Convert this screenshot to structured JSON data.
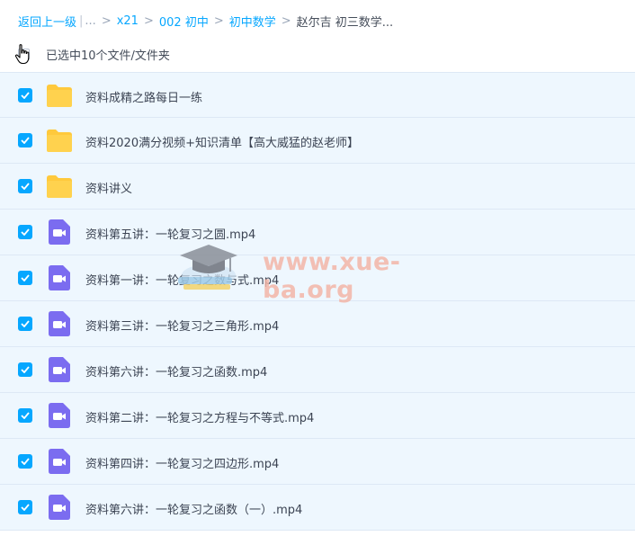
{
  "breadcrumb": {
    "back": "返回上一级",
    "more": "...",
    "items": [
      "x21",
      "002 初中",
      "初中数学"
    ],
    "current": "赵尔吉 初三数学..."
  },
  "selection": {
    "text": "已选中10个文件/文件夹"
  },
  "files": [
    {
      "type": "folder",
      "name": "资料成精之路每日一练"
    },
    {
      "type": "folder",
      "name": "资料2020满分视频+知识清单【高大威猛的赵老师】"
    },
    {
      "type": "folder",
      "name": "资料讲义"
    },
    {
      "type": "video",
      "name": "资料第五讲：一轮复习之圆.mp4"
    },
    {
      "type": "video",
      "name": "资料第一讲：一轮复习之数与式.mp4"
    },
    {
      "type": "video",
      "name": "资料第三讲：一轮复习之三角形.mp4"
    },
    {
      "type": "video",
      "name": "资料第六讲：一轮复习之函数.mp4"
    },
    {
      "type": "video",
      "name": "资料第二讲：一轮复习之方程与不等式.mp4"
    },
    {
      "type": "video",
      "name": "资料第四讲：一轮复习之四边形.mp4"
    },
    {
      "type": "video",
      "name": "资料第六讲：一轮复习之函数（一）.mp4"
    }
  ],
  "watermark": {
    "text": "www.xue-ba.org"
  },
  "colors": {
    "accent": "#06a7ff",
    "folder": "#ffc93c",
    "video": "#7b6cf0",
    "row_bg": "#eef7fe"
  }
}
